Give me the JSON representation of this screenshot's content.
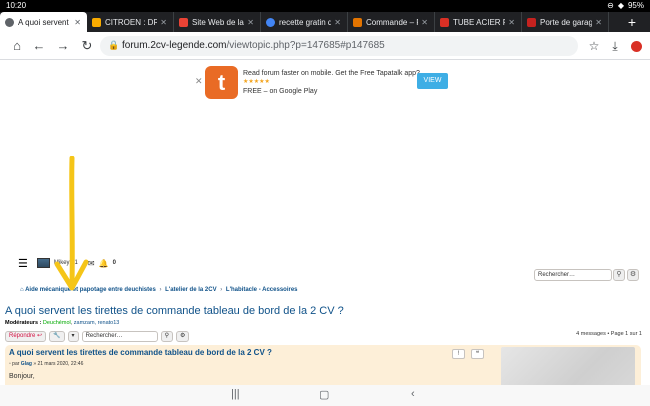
{
  "status": {
    "time": "10:20",
    "battery": "95%"
  },
  "tabs": [
    {
      "label": "A quoi servent l",
      "favicon_color": "#5f6368",
      "active": true
    },
    {
      "label": "CITROEN : DRÔ",
      "favicon_color": "#f9ab00",
      "active": false
    },
    {
      "label": "Site Web de la 2",
      "favicon_color": "#ea4335",
      "active": false
    },
    {
      "label": "recette gratin d",
      "favicon_color": "#4285f4",
      "active": false
    },
    {
      "label": "Commande – R",
      "favicon_color": "#e37400",
      "active": false
    },
    {
      "label": "TUBE ACIER RO",
      "favicon_color": "#d93025",
      "active": false
    },
    {
      "label": "Porte de garag",
      "favicon_color": "#c5221f",
      "active": false
    }
  ],
  "toolbar": {
    "url_host": "forum.2cv-legende.com",
    "url_path": "/viewtopic.php?p=147685#p147685"
  },
  "banner": {
    "line1": "Read forum faster on mobile. Get the Free Tapatalk app?",
    "stars": "★★★★★",
    "line3": "FREE – on Google Play",
    "logo_letter": "t",
    "view_label": "VIEW"
  },
  "forum": {
    "username": "Mikey 71",
    "notif_count": "0",
    "search_placeholder": "Rechercher…",
    "breadcrumb": [
      "Aide mécanique et papotage entre deuchistes",
      "L'atelier de la 2CV",
      "L'habitacle - Accessoires"
    ],
    "topic_title": "A quoi servent les tirettes de commande tableau de bord de la 2 CV ?",
    "moderators_label": "Modérateurs :",
    "moderators": [
      "Deuchémol",
      "zamzam, renato13"
    ],
    "reply_label": "Répondre",
    "tools_label": "🔧",
    "topic_search_placeholder": "Rechercher…",
    "pagination": "4 messages • Page 1 sur 1"
  },
  "post": {
    "title": "A quoi servent les tirettes de commande tableau de bord de la 2 CV ?",
    "meta_prefix": "par",
    "author": "Glag",
    "date": "» 21 mars 2020, 22:46",
    "body": "Bonjour,"
  },
  "colors": {
    "annotation_arrow": "#f5c518",
    "link_blue": "#105289",
    "post_bg": "#fdefd8"
  }
}
